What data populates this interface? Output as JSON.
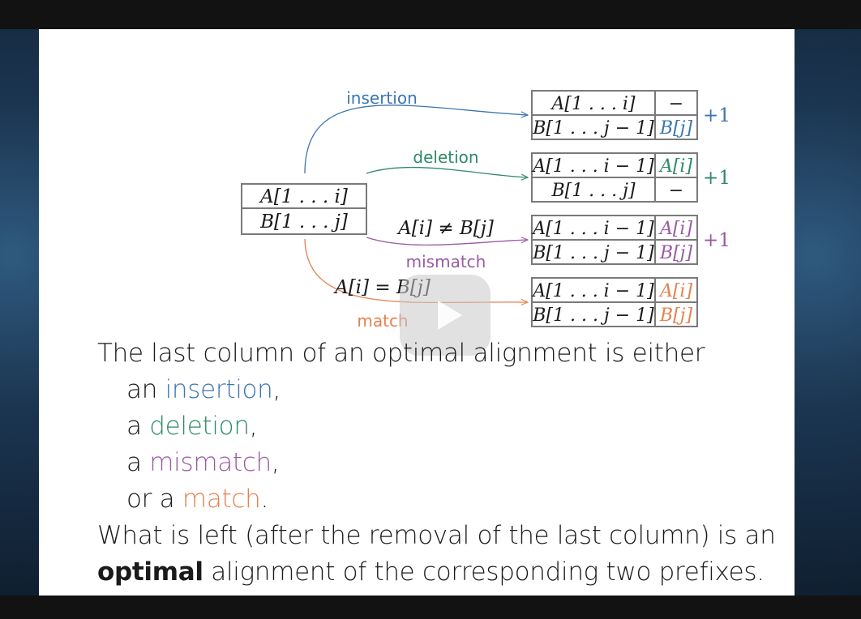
{
  "diagram": {
    "source": {
      "top": "A[1 . . . i]",
      "bottom": "B[1 . . . j]"
    },
    "edges": [
      {
        "key": "insertion",
        "label": "insertion",
        "color": "#3c76b0"
      },
      {
        "key": "deletion",
        "label": "deletion",
        "color": "#2f8a66"
      },
      {
        "key": "mismatch",
        "label": "mismatch",
        "condition": "A[i] ≠ B[j]",
        "color": "#9a5aa3"
      },
      {
        "key": "match",
        "label": "match",
        "condition": "A[i] = B[j]",
        "color": "#e58250"
      }
    ],
    "targets": [
      {
        "key": "insertion",
        "a_prefix": "A[1 . . . i]",
        "a_last": "−",
        "b_prefix": "B[1 . . . j − 1]",
        "b_last": "B[j]",
        "cost": "+1"
      },
      {
        "key": "deletion",
        "a_prefix": "A[1 . . . i − 1]",
        "a_last": "A[i]",
        "b_prefix": "B[1 . . . j]",
        "b_last": "−",
        "cost": "+1"
      },
      {
        "key": "mismatch",
        "a_prefix": "A[1 . . . i − 1]",
        "a_last": "A[i]",
        "b_prefix": "B[1 . . . j − 1]",
        "b_last": "B[j]",
        "cost": "+1"
      },
      {
        "key": "match",
        "a_prefix": "A[1 . . . i − 1]",
        "a_last": "A[i]",
        "b_prefix": "B[1 . . . j − 1]",
        "b_last": "B[j]",
        "cost": ""
      }
    ]
  },
  "text": {
    "intro": "The last column of an optimal alignment is either",
    "item1_pre": "an ",
    "item1_word": "insertion",
    "item1_post": ",",
    "item2_pre": "a ",
    "item2_word": "deletion",
    "item2_post": ",",
    "item3_pre": "a ",
    "item3_word": "mismatch",
    "item3_post": ",",
    "item4_pre": "or a ",
    "item4_word": "match",
    "item4_post": ".",
    "conclusion1": "What is left (after the removal of the last column) is an",
    "conclusion2_bold": "optimal",
    "conclusion2_rest": " alignment of the corresponding two prefixes."
  },
  "colors": {
    "insertion": "#3c76b0",
    "deletion": "#2f8a66",
    "mismatch": "#9a5aa3",
    "match": "#e58250",
    "box_border": "#7a7a7a"
  },
  "icons": {
    "video_overlay": "play-icon"
  }
}
